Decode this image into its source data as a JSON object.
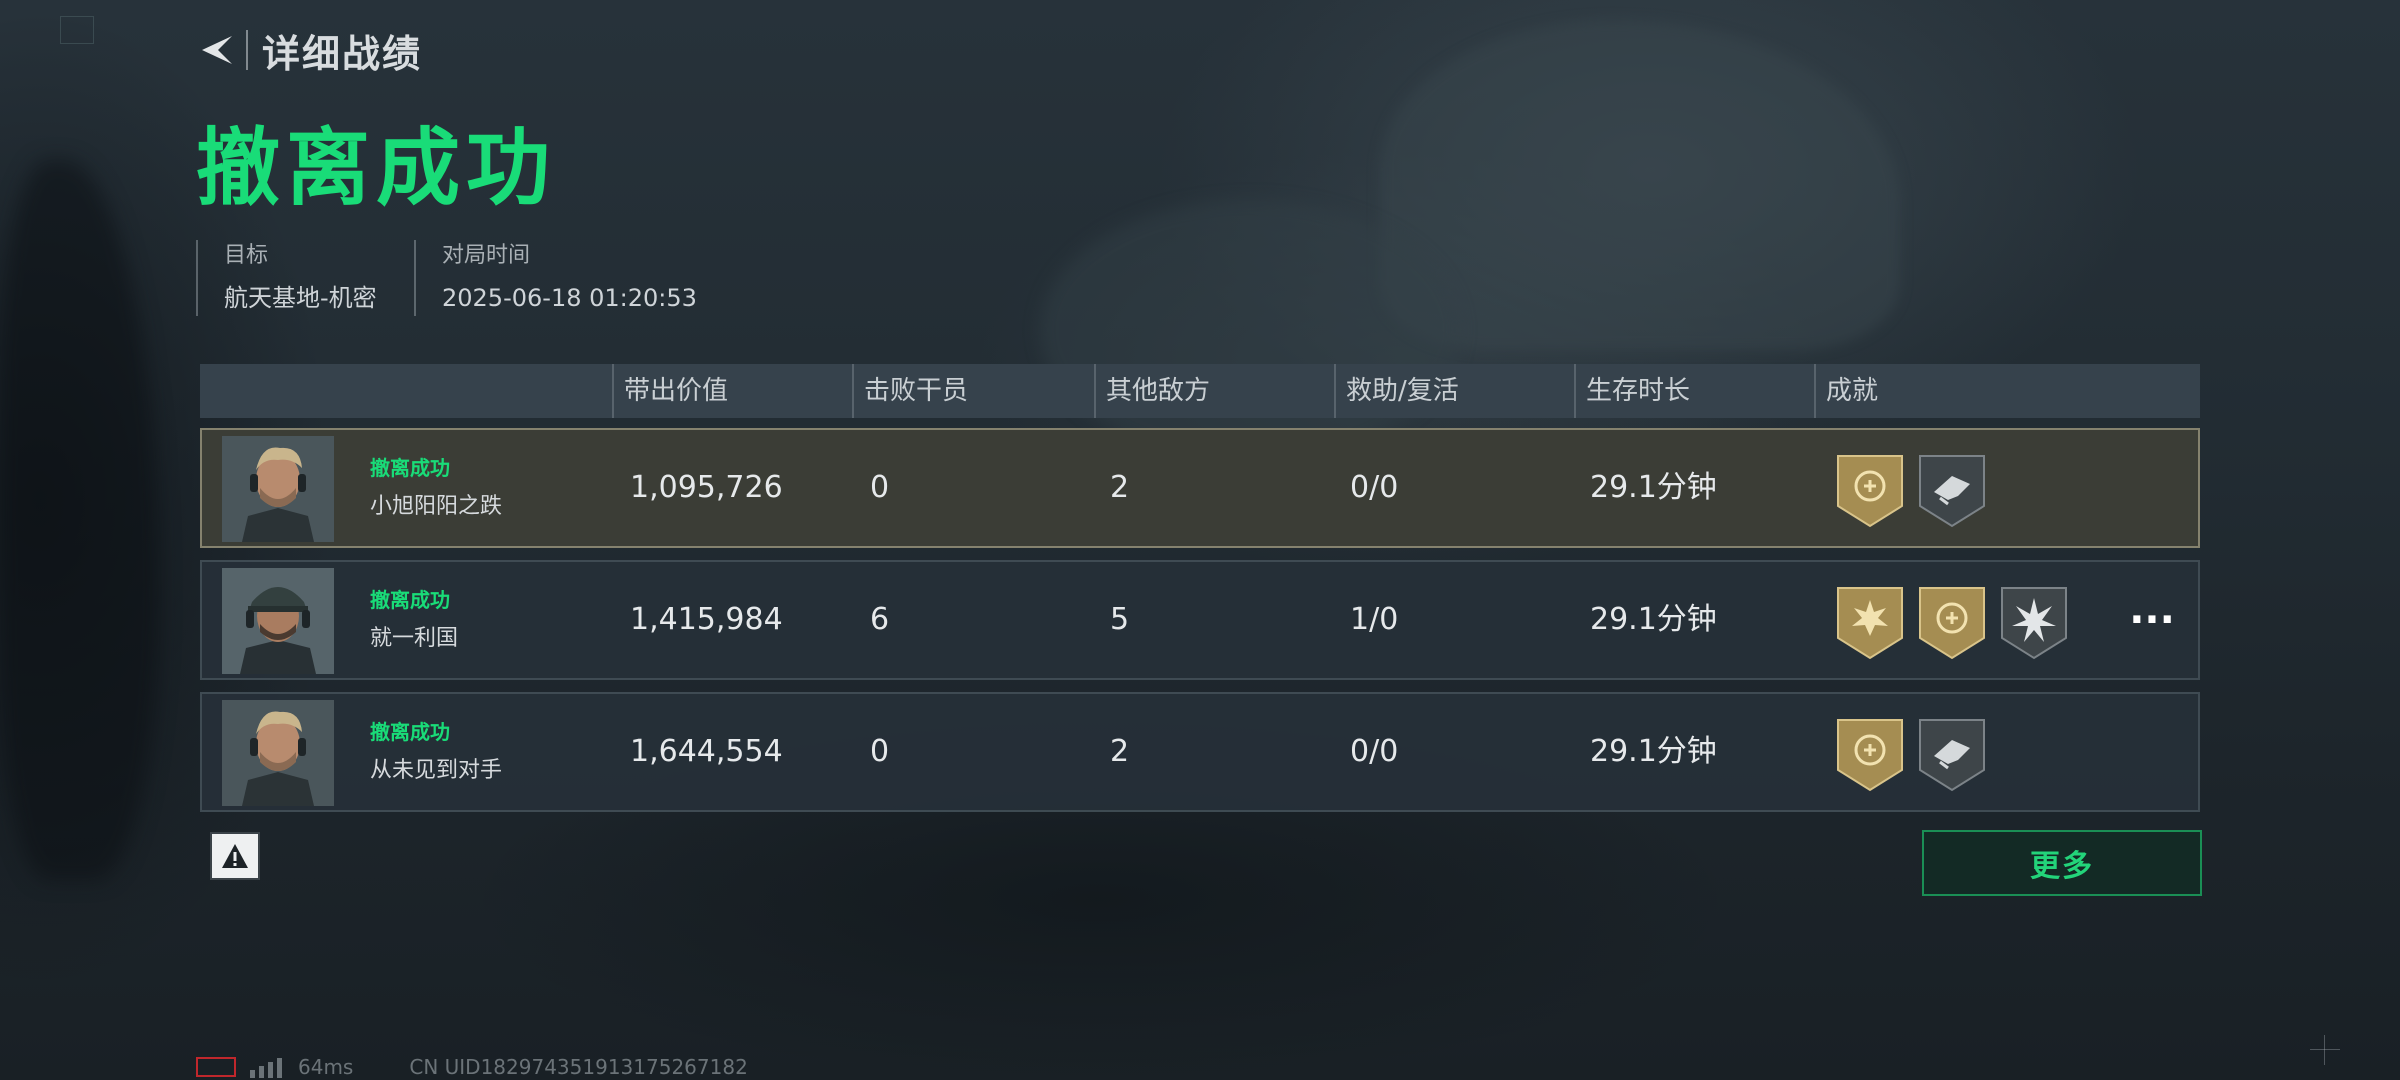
{
  "header": {
    "title": "详细战绩"
  },
  "result": {
    "title": "撤离成功"
  },
  "meta": {
    "target_label": "目标",
    "target_value": "航天基地-机密",
    "time_label": "对局时间",
    "time_value": "2025-06-18 01:20:53"
  },
  "table": {
    "columns": [
      "",
      "带出价值",
      "击败干员",
      "其他敌方",
      "救助/复活",
      "生存时长",
      "成就"
    ],
    "rows": [
      {
        "status": "撤离成功",
        "name": "小旭阳阳之跌",
        "value": "1,095,726",
        "kills": "0",
        "others": "2",
        "assist": "0/0",
        "duration": "29.1分钟",
        "badges": [
          "gold-laurel-medal-icon",
          "gray-wing-medal-icon"
        ],
        "selected": true
      },
      {
        "status": "撤离成功",
        "name": "就一利国",
        "value": "1,415,984",
        "kills": "6",
        "others": "5",
        "assist": "1/0",
        "duration": "29.1分钟",
        "badges": [
          "gold-star-medal-icon",
          "gold-laurel-medal-icon",
          "gray-burst-medal-icon"
        ],
        "selected": false,
        "has_more": true
      },
      {
        "status": "撤离成功",
        "name": "从未见到对手",
        "value": "1,644,554",
        "kills": "0",
        "others": "2",
        "assist": "0/0",
        "duration": "29.1分钟",
        "badges": [
          "gold-laurel-medal-icon",
          "gray-wing-medal-icon"
        ],
        "selected": false
      }
    ]
  },
  "buttons": {
    "more": "更多",
    "more_dots": "···"
  },
  "footer": {
    "ping": "64ms",
    "uid": "CN UID182974351913175267182"
  },
  "colors": {
    "accent": "#19dc78",
    "gold": "#b8a061",
    "selected_border": "#85826e"
  }
}
